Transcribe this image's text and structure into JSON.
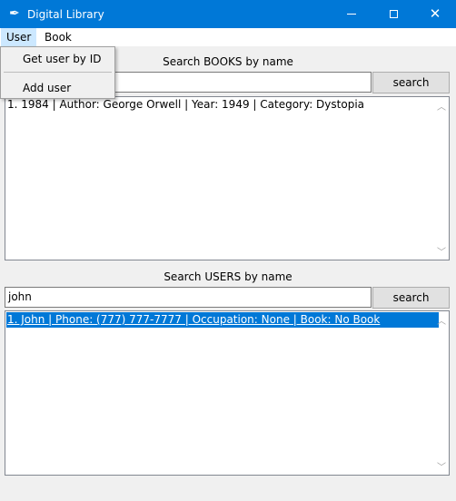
{
  "window": {
    "title": "Digital Library",
    "app_icon": "feather-icon",
    "accent_color": "#0078d7"
  },
  "menubar": {
    "items": [
      {
        "label": "User"
      },
      {
        "label": "Book"
      }
    ],
    "user_menu": {
      "items": [
        {
          "label": "Get user by ID"
        },
        {
          "label": "Add user"
        }
      ]
    }
  },
  "books": {
    "heading": "Search BOOKS by name",
    "query": "",
    "search_label": "search",
    "results": [
      "1. 1984 | Author: George Orwell | Year: 1949 | Category: Dystopia"
    ]
  },
  "users": {
    "heading": "Search USERS by name",
    "query": "john",
    "search_label": "search",
    "results": [
      "1. John | Phone: (777) 777-7777 | Occupation: None | Book: No Book"
    ],
    "selected_index": 0
  }
}
